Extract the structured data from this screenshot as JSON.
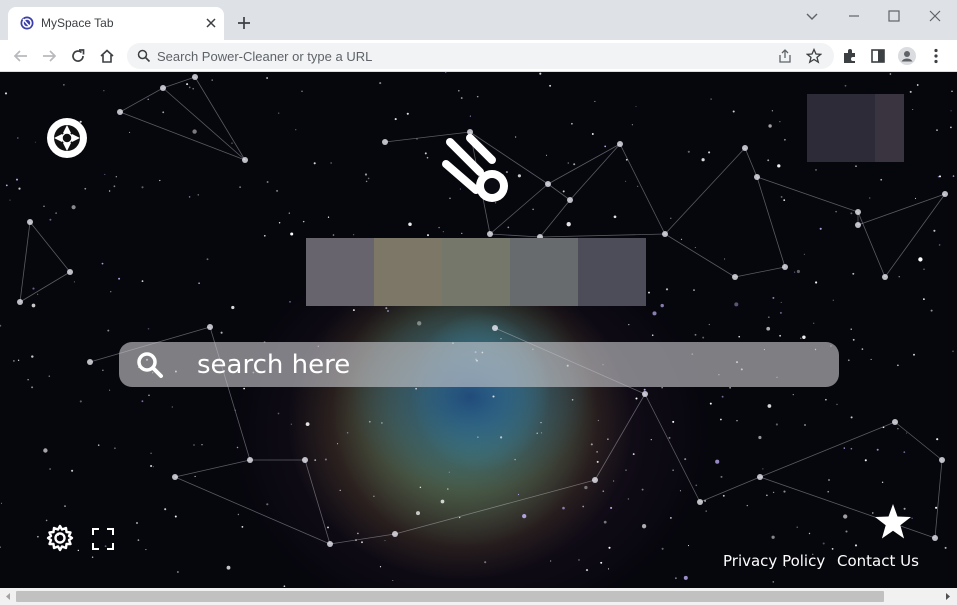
{
  "browser": {
    "tab_title": "MySpace Tab",
    "address_placeholder": "Search Power-Cleaner or type a URL"
  },
  "page": {
    "search_placeholder": "search here",
    "footer_links": [
      "Privacy Policy",
      "Contact Us"
    ]
  },
  "icons": {
    "tab": [
      "favicon-icon",
      "close-icon",
      "plus-icon"
    ],
    "window": [
      "chevron-down-icon",
      "minimize-icon",
      "maximize-icon",
      "close-icon"
    ],
    "toolbar": [
      "back-icon",
      "forward-icon",
      "reload-icon",
      "home-icon",
      "search-icon",
      "share-icon",
      "bookmark-star-icon",
      "extensions-icon",
      "side-panel-icon",
      "profile-icon",
      "menu-icon"
    ],
    "page": [
      "aperture-logo-icon",
      "comet-icon",
      "search-icon",
      "gear-icon",
      "fullscreen-icon",
      "star-icon"
    ]
  },
  "colors": {
    "searchbar": "#c8c8cd",
    "thumbnails": [
      "#67646e",
      "#7c7767",
      "#75776a",
      "#676b6e",
      "#4c4d59"
    ],
    "thumbnail_top": [
      "#2c2b37",
      "#3a3440"
    ]
  }
}
